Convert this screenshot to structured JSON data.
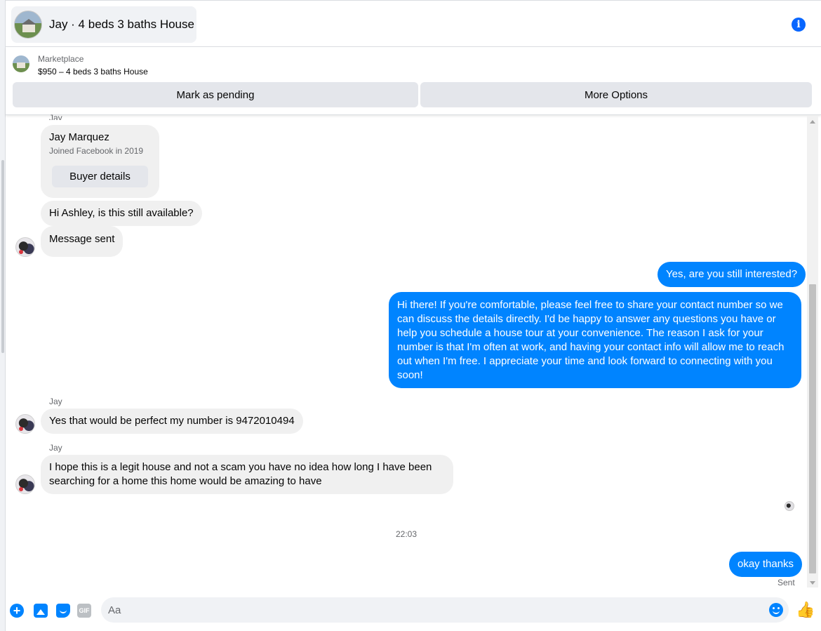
{
  "header": {
    "title": "Jay · 4 beds 3 baths House"
  },
  "listing": {
    "source_label": "Marketplace",
    "price_title": "$950 – 4 beds 3 baths House",
    "mark_pending_label": "Mark as pending",
    "more_options_label": "More Options"
  },
  "profile": {
    "sender_label": "Jay",
    "name": "Jay Marquez",
    "joined": "Joined Facebook in 2019",
    "buyer_details_label": "Buyer details"
  },
  "messages": [
    {
      "from": "in",
      "text": "Hi Ashley, is this still available?"
    },
    {
      "from": "in",
      "text": "Message sent"
    },
    {
      "from": "out",
      "text": "Yes, are you still interested?"
    },
    {
      "from": "out",
      "text": "Hi there! If you're comfortable, please feel free to share your contact number so we can discuss the details directly. I'd be happy to answer any questions you have or help you schedule a house tour at your convenience. The reason I ask for your number is that I'm often at work, and having your contact info will allow me to reach out when I'm free. I appreciate your time and look forward to connecting with you soon!"
    },
    {
      "from": "in",
      "sender": "Jay",
      "text": "Yes that would be perfect my number  is 9472010494"
    },
    {
      "from": "in",
      "sender": "Jay",
      "text": "I hope this is a legit house and not a scam you have no idea how long I have been searching for a home this home would be amazing to have"
    },
    {
      "from": "out",
      "text": "okay thanks"
    }
  ],
  "timestamp": "22:03",
  "sent_status": "Sent",
  "composer": {
    "placeholder": "Aa",
    "gif_label": "GIF"
  },
  "colors": {
    "accent": "#0084ff",
    "incoming_bubble": "#f0f0f0",
    "button_bg": "#e4e6eb"
  },
  "icons": [
    "info-icon",
    "plus-icon",
    "photo-icon",
    "sticker-icon",
    "gif-icon",
    "emoji-icon",
    "like-icon"
  ]
}
